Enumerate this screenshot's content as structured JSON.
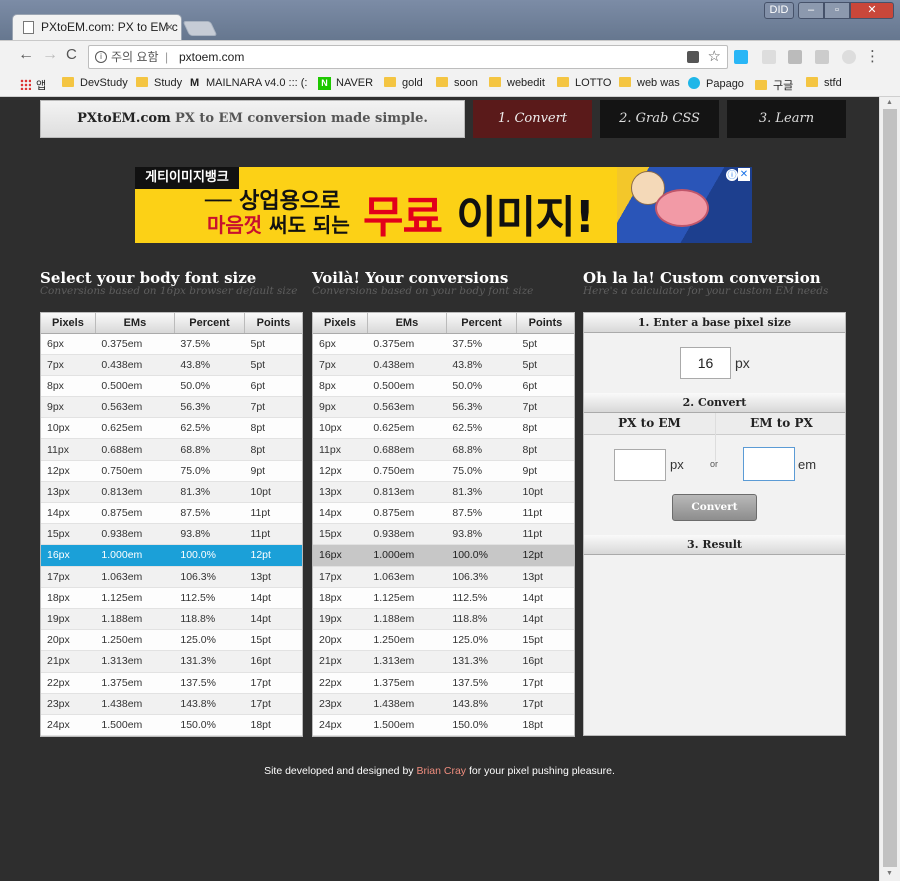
{
  "browser": {
    "window_user": "DID",
    "tab_title": "PXtoEM.com: PX to EM c",
    "tab_close": "×",
    "nav": {
      "back": "←",
      "forward": "→",
      "reload": "C"
    },
    "address": {
      "security_label": "주의 요함",
      "separator": "|",
      "url": "pxtoem.com"
    },
    "bookmarks": [
      "앱",
      "DevStudy",
      "Study",
      "MAILNARA v4.0 ::: (:",
      "NAVER",
      "gold",
      "soon",
      "webedit",
      "LOTTO",
      "web was",
      "Papago",
      "구글",
      "stfd"
    ]
  },
  "site": {
    "brand_name": "PXtoEM.com",
    "brand_tagline": "PX to EM conversion made simple.",
    "nav": [
      "1. Convert",
      "2. Grab CSS",
      "3. Learn"
    ],
    "active_nav": "1. Convert"
  },
  "ad": {
    "tag": "게티이미지뱅크",
    "line1": "── 상업용으로",
    "line2_red": "마음껏",
    "line2_black": " 써도 되는",
    "big_red": "무료",
    "big_black": " 이미지!",
    "info": "ⓘ",
    "close": "✕"
  },
  "sections": {
    "left": {
      "title": "Select your body font size",
      "subtitle": "Conversions based on 16px browser default size"
    },
    "middle": {
      "title": "Voilà! Your conversions",
      "subtitle": "Conversions based on your body font size"
    },
    "right": {
      "title": "Oh la la! Custom conversion",
      "subtitle": "Here's a calculator for your custom EM needs"
    }
  },
  "table": {
    "headers": [
      "Pixels",
      "EMs",
      "Percent",
      "Points"
    ],
    "rows": [
      [
        "6px",
        "0.375em",
        "37.5%",
        "5pt"
      ],
      [
        "7px",
        "0.438em",
        "43.8%",
        "5pt"
      ],
      [
        "8px",
        "0.500em",
        "50.0%",
        "6pt"
      ],
      [
        "9px",
        "0.563em",
        "56.3%",
        "7pt"
      ],
      [
        "10px",
        "0.625em",
        "62.5%",
        "8pt"
      ],
      [
        "11px",
        "0.688em",
        "68.8%",
        "8pt"
      ],
      [
        "12px",
        "0.750em",
        "75.0%",
        "9pt"
      ],
      [
        "13px",
        "0.813em",
        "81.3%",
        "10pt"
      ],
      [
        "14px",
        "0.875em",
        "87.5%",
        "11pt"
      ],
      [
        "15px",
        "0.938em",
        "93.8%",
        "11pt"
      ],
      [
        "16px",
        "1.000em",
        "100.0%",
        "12pt"
      ],
      [
        "17px",
        "1.063em",
        "106.3%",
        "13pt"
      ],
      [
        "18px",
        "1.125em",
        "112.5%",
        "14pt"
      ],
      [
        "19px",
        "1.188em",
        "118.8%",
        "14pt"
      ],
      [
        "20px",
        "1.250em",
        "125.0%",
        "15pt"
      ],
      [
        "21px",
        "1.313em",
        "131.3%",
        "16pt"
      ],
      [
        "22px",
        "1.375em",
        "137.5%",
        "17pt"
      ],
      [
        "23px",
        "1.438em",
        "143.8%",
        "17pt"
      ],
      [
        "24px",
        "1.500em",
        "150.0%",
        "18pt"
      ]
    ],
    "selected_pixel": "16px"
  },
  "custom": {
    "step1": "1. Enter a base pixel size",
    "base_value": "16",
    "base_unit": "px",
    "step2": "2. Convert",
    "px_to_em": "PX to EM",
    "em_to_px": "EM to PX",
    "px_unit": "px",
    "or": "or",
    "em_unit": "em",
    "convert_button": "Convert",
    "step3": "3. Result"
  },
  "footer": {
    "prefix": "Site developed and designed by ",
    "author": "Brian Cray",
    "suffix": " for your pixel pushing pleasure."
  },
  "colors": {
    "accent_selected": "#1ba0d8",
    "active_nav": "#5a1a1a",
    "link": "#ef8d7e",
    "page_bg": "#2e2e2e"
  }
}
